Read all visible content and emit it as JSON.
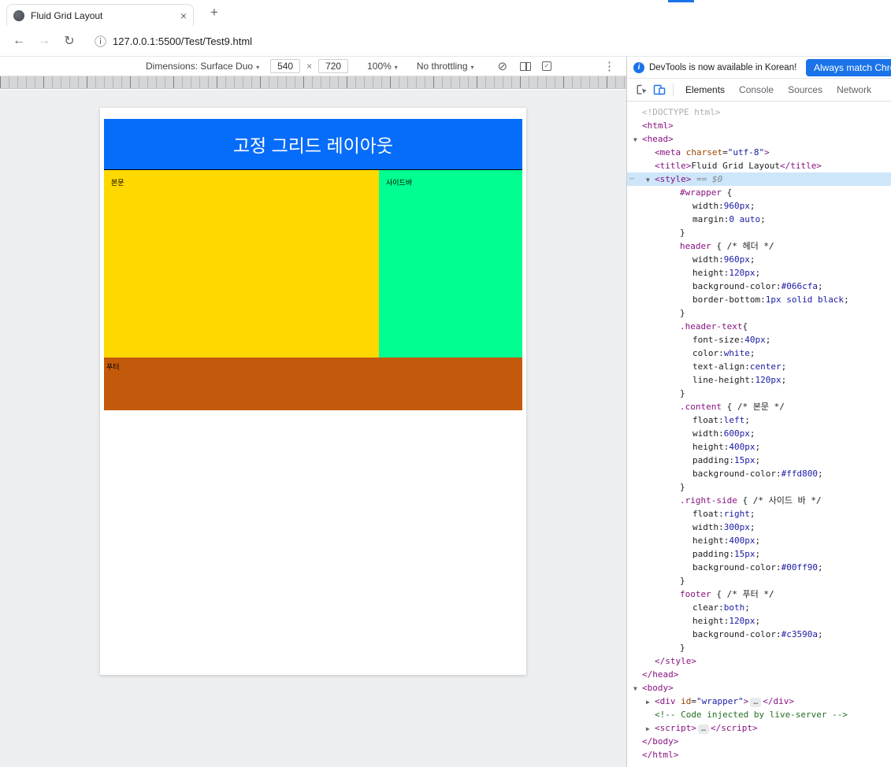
{
  "accent": {
    "blue": "#1a73e8"
  },
  "icons": {
    "back": "←",
    "forward": "→",
    "reload": "↻",
    "info": "ⓘ",
    "caret": "▾",
    "close": "×",
    "new_tab": "+",
    "multiply": "×",
    "block": "⊘",
    "check": "✓",
    "more": "⋮",
    "notice_i": "i",
    "gutter": "⋯"
  },
  "browser_tab": {
    "title": "Fluid Grid Layout"
  },
  "navbar": {
    "url": "127.0.0.1:5500/Test/Test9.html"
  },
  "device_toolbar": {
    "dimensions_label": "Dimensions: Surface Duo",
    "width_value": "540",
    "height_value": "720",
    "zoom_value": "100%",
    "throttle_value": "No throttling"
  },
  "rendered_page": {
    "header_text": "고정 그리드 레이아웃",
    "content_label": "본문",
    "sidebar_label": "사이드바",
    "footer_label": "푸터",
    "header_color": "#066cfa",
    "content_color": "#ffd800",
    "sidebar_color": "#00ff90",
    "footer_color": "#c3590a"
  },
  "devtools": {
    "notice_text": "DevTools is now available in Korean!",
    "notice_button": "Always match Chro",
    "tabs": [
      {
        "label": "Elements",
        "selected": true
      },
      {
        "label": "Console",
        "selected": false
      },
      {
        "label": "Sources",
        "selected": false
      },
      {
        "label": "Network",
        "selected": false
      }
    ],
    "tree": [
      {
        "i": 0,
        "t": [
          [
            "doc",
            "<!DOCTYPE html>"
          ]
        ]
      },
      {
        "i": 0,
        "t": [
          [
            "tag",
            "<html>"
          ]
        ]
      },
      {
        "i": 0,
        "a": "d",
        "t": [
          [
            "tag",
            "<head>"
          ]
        ]
      },
      {
        "i": 1,
        "t": [
          [
            "tag",
            "<meta "
          ],
          [
            "attr",
            "charset"
          ],
          [
            "pln",
            "="
          ],
          [
            "val",
            "\"utf-8\""
          ],
          [
            "tag",
            ">"
          ]
        ]
      },
      {
        "i": 1,
        "t": [
          [
            "tag",
            "<title>"
          ],
          [
            "txt",
            "Fluid Grid Layout"
          ],
          [
            "tag",
            "</title>"
          ]
        ]
      },
      {
        "i": 1,
        "a": "d",
        "s": 1,
        "g": 1,
        "t": [
          [
            "tag",
            "<style>"
          ],
          [
            "mark",
            " == $0"
          ]
        ]
      },
      {
        "i": 3,
        "t": [
          [
            "css-s",
            "#wrapper"
          ],
          [
            "pln",
            " {"
          ]
        ]
      },
      {
        "i": 4,
        "t": [
          [
            "css-p",
            "width"
          ],
          [
            "pln",
            ":"
          ],
          [
            "css-v",
            "960px"
          ],
          [
            "pln",
            ";"
          ]
        ]
      },
      {
        "i": 4,
        "t": [
          [
            "css-p",
            "margin"
          ],
          [
            "pln",
            ":"
          ],
          [
            "css-v",
            "0 auto"
          ],
          [
            "pln",
            ";"
          ]
        ]
      },
      {
        "i": 3,
        "t": [
          [
            "pln",
            "}"
          ]
        ]
      },
      {
        "i": 3,
        "t": [
          [
            "css-s",
            "header"
          ],
          [
            "pln",
            " {  "
          ],
          [
            "css-c",
            "/* 헤더 */"
          ]
        ]
      },
      {
        "i": 4,
        "t": [
          [
            "css-p",
            "width"
          ],
          [
            "pln",
            ":"
          ],
          [
            "css-v",
            "960px"
          ],
          [
            "pln",
            ";"
          ]
        ]
      },
      {
        "i": 4,
        "t": [
          [
            "css-p",
            "height"
          ],
          [
            "pln",
            ":"
          ],
          [
            "css-v",
            "120px"
          ],
          [
            "pln",
            ";"
          ]
        ]
      },
      {
        "i": 4,
        "t": [
          [
            "css-p",
            "background-color"
          ],
          [
            "pln",
            ":"
          ],
          [
            "css-v",
            "#066cfa"
          ],
          [
            "pln",
            ";"
          ]
        ]
      },
      {
        "i": 4,
        "t": [
          [
            "css-p",
            "border-bottom"
          ],
          [
            "pln",
            ":"
          ],
          [
            "css-v",
            "1px solid black"
          ],
          [
            "pln",
            ";"
          ]
        ]
      },
      {
        "i": 3,
        "t": [
          [
            "pln",
            "}"
          ]
        ]
      },
      {
        "i": 3,
        "t": [
          [
            "css-s",
            ".header-text"
          ],
          [
            "pln",
            "{"
          ]
        ]
      },
      {
        "i": 4,
        "t": [
          [
            "css-p",
            "font-size"
          ],
          [
            "pln",
            ":"
          ],
          [
            "css-v",
            "40px"
          ],
          [
            "pln",
            ";"
          ]
        ]
      },
      {
        "i": 4,
        "t": [
          [
            "css-p",
            "color"
          ],
          [
            "pln",
            ":"
          ],
          [
            "css-v",
            "white"
          ],
          [
            "pln",
            ";"
          ]
        ]
      },
      {
        "i": 4,
        "t": [
          [
            "css-p",
            "text-align"
          ],
          [
            "pln",
            ":"
          ],
          [
            "css-v",
            "center"
          ],
          [
            "pln",
            ";"
          ]
        ]
      },
      {
        "i": 4,
        "t": [
          [
            "css-p",
            "line-height"
          ],
          [
            "pln",
            ":"
          ],
          [
            "css-v",
            "120px"
          ],
          [
            "pln",
            ";"
          ]
        ]
      },
      {
        "i": 3,
        "t": [
          [
            "pln",
            "}"
          ]
        ]
      },
      {
        "i": 3,
        "t": [
          [
            "css-s",
            ".content"
          ],
          [
            "pln",
            " {   "
          ],
          [
            "css-c",
            "/* 본문 */"
          ]
        ]
      },
      {
        "i": 4,
        "t": [
          [
            "css-p",
            "float"
          ],
          [
            "pln",
            ":"
          ],
          [
            "css-v",
            "left"
          ],
          [
            "pln",
            ";"
          ]
        ]
      },
      {
        "i": 4,
        "t": [
          [
            "css-p",
            "width"
          ],
          [
            "pln",
            ":"
          ],
          [
            "css-v",
            "600px"
          ],
          [
            "pln",
            ";"
          ]
        ]
      },
      {
        "i": 4,
        "t": [
          [
            "css-p",
            "height"
          ],
          [
            "pln",
            ":"
          ],
          [
            "css-v",
            "400px"
          ],
          [
            "pln",
            ";"
          ]
        ]
      },
      {
        "i": 4,
        "t": [
          [
            "css-p",
            "padding"
          ],
          [
            "pln",
            ":"
          ],
          [
            "css-v",
            "15px"
          ],
          [
            "pln",
            ";"
          ]
        ]
      },
      {
        "i": 4,
        "t": [
          [
            "css-p",
            "background-color"
          ],
          [
            "pln",
            ":"
          ],
          [
            "css-v",
            "#ffd800"
          ],
          [
            "pln",
            ";"
          ]
        ]
      },
      {
        "i": 3,
        "t": [
          [
            "pln",
            "}"
          ]
        ]
      },
      {
        "i": 3,
        "t": [
          [
            "css-s",
            ".right-side"
          ],
          [
            "pln",
            " {  "
          ],
          [
            "css-c",
            "/* 사이드 바 */"
          ]
        ]
      },
      {
        "i": 4,
        "t": [
          [
            "css-p",
            "float"
          ],
          [
            "pln",
            ":"
          ],
          [
            "css-v",
            "right"
          ],
          [
            "pln",
            ";"
          ]
        ]
      },
      {
        "i": 4,
        "t": [
          [
            "css-p",
            "width"
          ],
          [
            "pln",
            ":"
          ],
          [
            "css-v",
            "300px"
          ],
          [
            "pln",
            ";"
          ]
        ]
      },
      {
        "i": 4,
        "t": [
          [
            "css-p",
            "height"
          ],
          [
            "pln",
            ":"
          ],
          [
            "css-v",
            "400px"
          ],
          [
            "pln",
            ";"
          ]
        ]
      },
      {
        "i": 4,
        "t": [
          [
            "css-p",
            "padding"
          ],
          [
            "pln",
            ":"
          ],
          [
            "css-v",
            "15px"
          ],
          [
            "pln",
            ";"
          ]
        ]
      },
      {
        "i": 4,
        "t": [
          [
            "css-p",
            "background-color"
          ],
          [
            "pln",
            ":"
          ],
          [
            "css-v",
            "#00ff90"
          ],
          [
            "pln",
            ";"
          ]
        ]
      },
      {
        "i": 3,
        "t": [
          [
            "pln",
            "}"
          ]
        ]
      },
      {
        "i": 3,
        "t": [
          [
            "css-s",
            "footer"
          ],
          [
            "pln",
            " {  "
          ],
          [
            "css-c",
            "/* 푸터 */"
          ]
        ]
      },
      {
        "i": 4,
        "t": [
          [
            "css-p",
            "clear"
          ],
          [
            "pln",
            ":"
          ],
          [
            "css-v",
            "both"
          ],
          [
            "pln",
            ";"
          ]
        ]
      },
      {
        "i": 4,
        "t": [
          [
            "css-p",
            "height"
          ],
          [
            "pln",
            ":"
          ],
          [
            "css-v",
            "120px"
          ],
          [
            "pln",
            ";"
          ]
        ]
      },
      {
        "i": 4,
        "t": [
          [
            "css-p",
            "background-color"
          ],
          [
            "pln",
            ":"
          ],
          [
            "css-v",
            "#c3590a"
          ],
          [
            "pln",
            ";"
          ]
        ]
      },
      {
        "i": 3,
        "t": [
          [
            "pln",
            "}"
          ]
        ]
      },
      {
        "i": 1,
        "t": [
          [
            "tag",
            "</style>"
          ]
        ]
      },
      {
        "i": 0,
        "t": [
          [
            "tag",
            "</head>"
          ]
        ]
      },
      {
        "i": 0,
        "a": "d",
        "t": [
          [
            "tag",
            "<body>"
          ]
        ]
      },
      {
        "i": 1,
        "a": "r",
        "t": [
          [
            "tag",
            "<div "
          ],
          [
            "attr",
            "id"
          ],
          [
            "pln",
            "="
          ],
          [
            "val",
            "\"wrapper\""
          ],
          [
            "tag",
            ">"
          ],
          [
            "ell",
            "…"
          ],
          [
            "tag",
            "</div>"
          ]
        ]
      },
      {
        "i": 1,
        "t": [
          [
            "com",
            "<!-- Code injected by live-server -->"
          ]
        ]
      },
      {
        "i": 1,
        "a": "r",
        "t": [
          [
            "tag",
            "<script>"
          ],
          [
            "ell",
            "…"
          ],
          [
            "tag",
            "</script>"
          ]
        ]
      },
      {
        "i": 0,
        "t": [
          [
            "tag",
            "</body>"
          ]
        ]
      },
      {
        "i": 0,
        "t": [
          [
            "tag",
            "</html>"
          ]
        ]
      }
    ]
  }
}
